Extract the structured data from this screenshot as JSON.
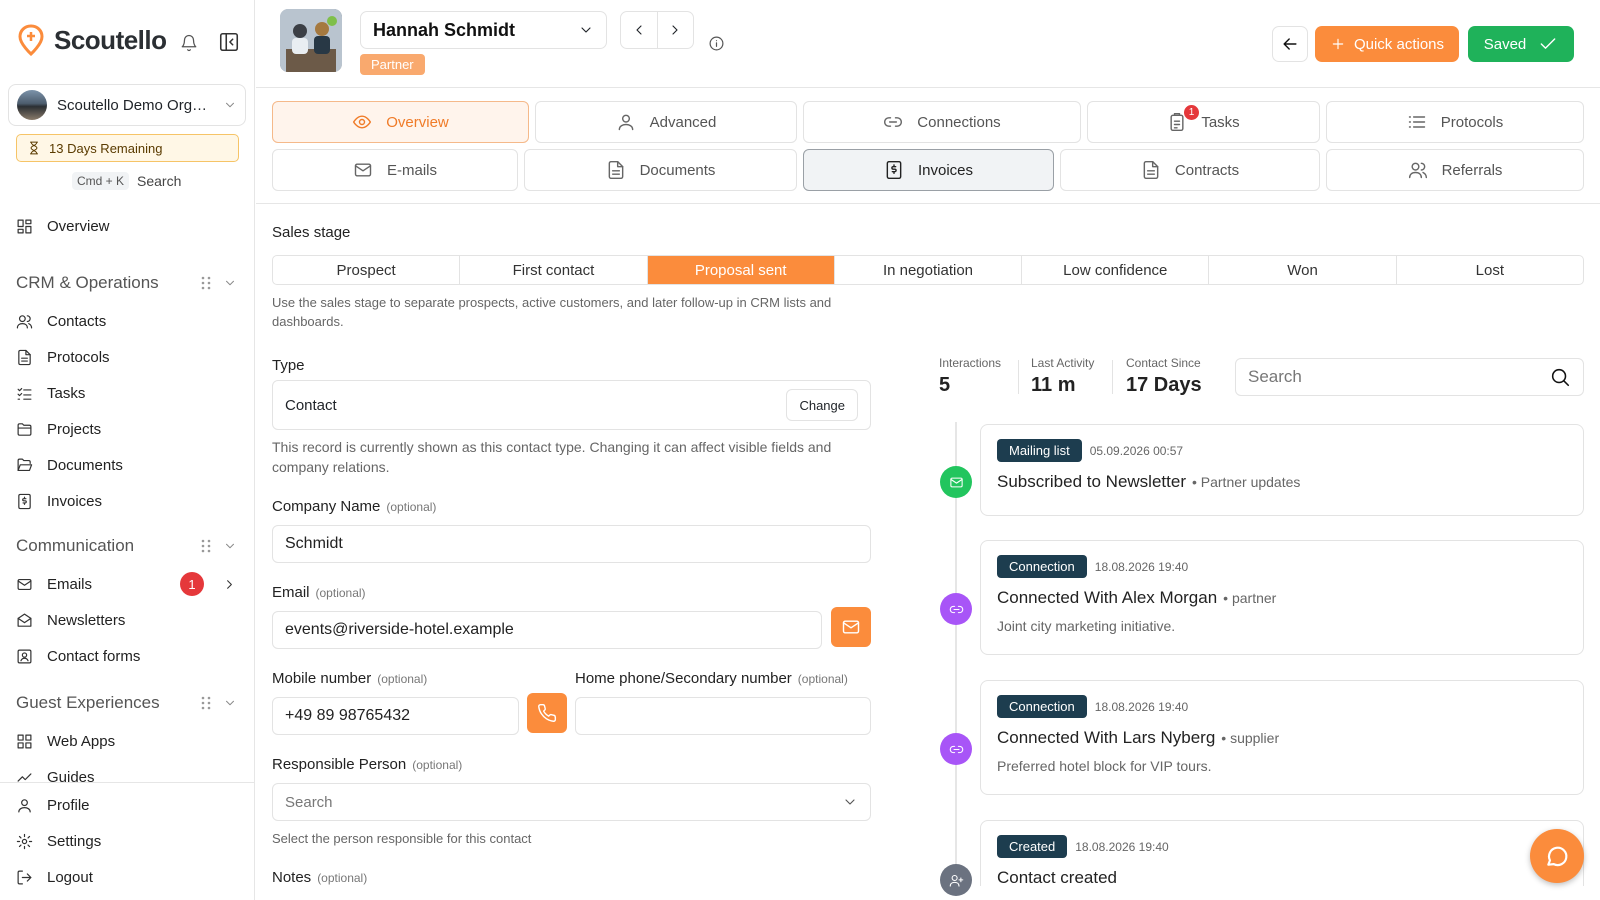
{
  "app": {
    "name": "Scoutello"
  },
  "sidebar": {
    "org_name": "Scoutello Demo Org…",
    "trial_text": "13 Days Remaining",
    "search_shortcut": "Cmd + K",
    "search_label": "Search",
    "top_items": [
      {
        "label": "Overview",
        "icon": "dashboard-icon"
      }
    ],
    "sections": [
      {
        "title": "CRM & Operations",
        "items": [
          {
            "label": "Contacts",
            "icon": "users-icon"
          },
          {
            "label": "Protocols",
            "icon": "file-icon"
          },
          {
            "label": "Tasks",
            "icon": "task-list-icon"
          },
          {
            "label": "Projects",
            "icon": "folder-icon"
          },
          {
            "label": "Documents",
            "icon": "folder-open-icon"
          },
          {
            "label": "Invoices",
            "icon": "invoice-icon"
          }
        ]
      },
      {
        "title": "Communication",
        "items": [
          {
            "label": "Emails",
            "icon": "mail-icon",
            "badge": "1"
          },
          {
            "label": "Newsletters",
            "icon": "newsletter-icon"
          },
          {
            "label": "Contact forms",
            "icon": "contact-form-icon"
          }
        ]
      },
      {
        "title": "Guest Experiences",
        "items": [
          {
            "label": "Web Apps",
            "icon": "grid-icon"
          },
          {
            "label": "Guides",
            "icon": "guide-icon"
          }
        ]
      }
    ],
    "bottom_items": [
      {
        "label": "Profile",
        "icon": "user-icon"
      },
      {
        "label": "Settings",
        "icon": "gear-icon"
      },
      {
        "label": "Logout",
        "icon": "logout-icon"
      }
    ]
  },
  "header": {
    "contact_name": "Hannah Schmidt",
    "tag": "Partner",
    "quick_actions": "Quick actions",
    "saved": "Saved"
  },
  "tabs": [
    {
      "label": "Overview",
      "icon": "eye-icon"
    },
    {
      "label": "Advanced",
      "icon": "user-icon"
    },
    {
      "label": "Connections",
      "icon": "link-icon"
    },
    {
      "label": "Tasks",
      "icon": "clipboard-icon",
      "badge": "1"
    },
    {
      "label": "Protocols",
      "icon": "list-icon"
    },
    {
      "label": "E-mails",
      "icon": "mail-icon"
    },
    {
      "label": "Documents",
      "icon": "file-icon"
    },
    {
      "label": "Invoices",
      "icon": "invoice-icon"
    },
    {
      "label": "Contracts",
      "icon": "file-icon"
    },
    {
      "label": "Referrals",
      "icon": "users-icon"
    }
  ],
  "form": {
    "sales_stage_label": "Sales stage",
    "stages": [
      "Prospect",
      "First contact",
      "Proposal sent",
      "In negotiation",
      "Low confidence",
      "Won",
      "Lost"
    ],
    "active_stage": "Proposal sent",
    "stage_help": "Use the sales stage to separate prospects, active customers, and later follow-up in CRM lists and dashboards.",
    "type_label": "Type",
    "type_value": "Contact",
    "change_label": "Change",
    "type_help": "This record is currently shown as this contact type. Changing it can affect visible fields and company relations.",
    "company_label": "Company Name",
    "optional": "(optional)",
    "company_value": "Schmidt",
    "email_label": "Email",
    "email_value": "events@riverside-hotel.example",
    "mobile_label": "Mobile number",
    "mobile_value": "+49 89 98765432",
    "home_label": "Home phone/Secondary number",
    "home_value": "",
    "responsible_label": "Responsible Person",
    "responsible_placeholder": "Search",
    "responsible_help": "Select the person responsible for this contact",
    "notes_label": "Notes"
  },
  "activity": {
    "stats": [
      {
        "label": "Interactions",
        "value": "5"
      },
      {
        "label": "Last Activity",
        "value": "11 m"
      },
      {
        "label": "Contact Since",
        "value": "17 Days"
      }
    ],
    "search_placeholder": "Search",
    "items": [
      {
        "tag": "Mailing list",
        "date": "05.09.2026 00:57",
        "title": "Subscribed to Newsletter",
        "sub": "• Partner updates",
        "desc": "",
        "node_color": "#22c55e",
        "icon": "mail-icon"
      },
      {
        "tag": "Connection",
        "date": "18.08.2026 19:40",
        "title": "Connected With Alex Morgan",
        "sub": "• partner",
        "desc": "Joint city marketing initiative.",
        "node_color": "#a855f7",
        "icon": "link-icon"
      },
      {
        "tag": "Connection",
        "date": "18.08.2026 19:40",
        "title": "Connected With Lars Nyberg",
        "sub": "• supplier",
        "desc": "Preferred hotel block for VIP tours.",
        "node_color": "#a855f7",
        "icon": "link-icon"
      },
      {
        "tag": "Created",
        "date": "18.08.2026 19:40",
        "title": "Contact created",
        "sub": "",
        "desc": "",
        "node_color": "#6b7280",
        "icon": "user-plus-icon"
      }
    ]
  },
  "colors": {
    "accent": "#fb8c3c",
    "success": "#1fb25a",
    "chip": "#1d3d4f",
    "danger": "#e5383b"
  }
}
